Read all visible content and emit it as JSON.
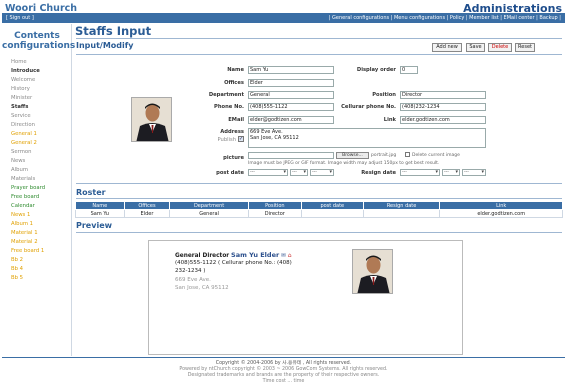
{
  "header": {
    "brand": "Woori Church",
    "admin_title": "Administrations"
  },
  "nav": {
    "signout": "[ Sign out ]",
    "links": "| General configurations | Menu configurations | Policy | Member list | EMail center | Backup |"
  },
  "sidebar": {
    "title_line1": "Contents",
    "title_line2": "configurations",
    "items": [
      {
        "label": "Home",
        "color": "gray"
      },
      {
        "label": "Introduce",
        "color": "dark"
      },
      {
        "label": "Welcome",
        "color": "gray"
      },
      {
        "label": "History",
        "color": "gray"
      },
      {
        "label": "Minister",
        "color": "gray"
      },
      {
        "label": "Staffs",
        "color": "dark"
      },
      {
        "label": "Service",
        "color": "gray"
      },
      {
        "label": "Direction",
        "color": "gray"
      },
      {
        "label": "General 1",
        "color": "orange"
      },
      {
        "label": "General 2",
        "color": "orange"
      },
      {
        "label": "Sermon",
        "color": "gray"
      },
      {
        "label": "News",
        "color": "gray"
      },
      {
        "label": "Album",
        "color": "gray"
      },
      {
        "label": "Materials",
        "color": "gray"
      },
      {
        "label": "Prayer board",
        "color": "green"
      },
      {
        "label": "Free board",
        "color": "green"
      },
      {
        "label": "Calendar",
        "color": "green"
      },
      {
        "label": "News 1",
        "color": "orange"
      },
      {
        "label": "Album 1",
        "color": "orange"
      },
      {
        "label": "Material 1",
        "color": "orange"
      },
      {
        "label": "Material 2",
        "color": "orange"
      },
      {
        "label": "Free board 1",
        "color": "orange"
      },
      {
        "label": "Bb 2",
        "color": "orange"
      },
      {
        "label": "Bb 4",
        "color": "orange"
      },
      {
        "label": "Bb 5",
        "color": "orange"
      }
    ]
  },
  "page": {
    "title": "Staffs Input",
    "section_input": "Input/Modify",
    "section_roster": "Roster",
    "section_preview": "Preview"
  },
  "buttons": {
    "add_new": "Add new",
    "save": "Save",
    "delete": "Delete",
    "reset": "Reset"
  },
  "form": {
    "name_label": "Name",
    "name_value": "Sam Yu",
    "display_order_label": "Display order",
    "display_order_value": "0",
    "offices_label": "Offices",
    "offices_value": "Elder",
    "department_label": "Department",
    "department_value": "General",
    "position_label": "Position",
    "position_value": "Director",
    "phone_label": "Phone No.",
    "phone_value": "(408)555-1122",
    "cell_label": "Cellurar phone No.",
    "cell_value": "(408)232-1234",
    "email_label": "EMail",
    "email_value": "elder@godtizen.com",
    "link_label": "Link",
    "link_value": "elder.godtizen.com",
    "address_label": "Address",
    "address_line1": "669 Eve Ave.",
    "address_line2": "San Jose, CA 95112",
    "publish_label": "Publish",
    "picture_label": "picture",
    "browse_label": "Browse...",
    "picture_file": "portrait.jpg",
    "delete_image_label": "Delete current image",
    "picture_hint": "Image must be JPEG or GIF format. Image width may adjust 150px to get best result.",
    "post_date_label": "post date",
    "resign_date_label": "Resign date",
    "date_blank": "---"
  },
  "roster": {
    "headers": [
      "Name",
      "Offices",
      "Department",
      "Position",
      "post date",
      "Resign date",
      "Link"
    ],
    "rows": [
      [
        "Sam Yu",
        "Elder",
        "General",
        "Director",
        "",
        "",
        "elder.godtizen.com"
      ]
    ]
  },
  "preview": {
    "position": "General Director",
    "name": "Sam Yu Elder",
    "phone_line1": "(408)555-1122 ( Cellurar phone No.: (408)",
    "phone_line2": "232-1234 )",
    "addr1": "669 Eve Ave.",
    "addr2": "San Jose, CA 95112"
  },
  "footer": {
    "line1": "Copyright © 2004-2006 by 사.용유테 , All rights reserved.",
    "line2": "Powered by ntChurch copyright © 2003 ~ 2006 GowCom Systems. All rights reserved.",
    "line3": "Designated trademarks and brands are the property of their respective owners.",
    "line4": "Time cost ... time"
  }
}
